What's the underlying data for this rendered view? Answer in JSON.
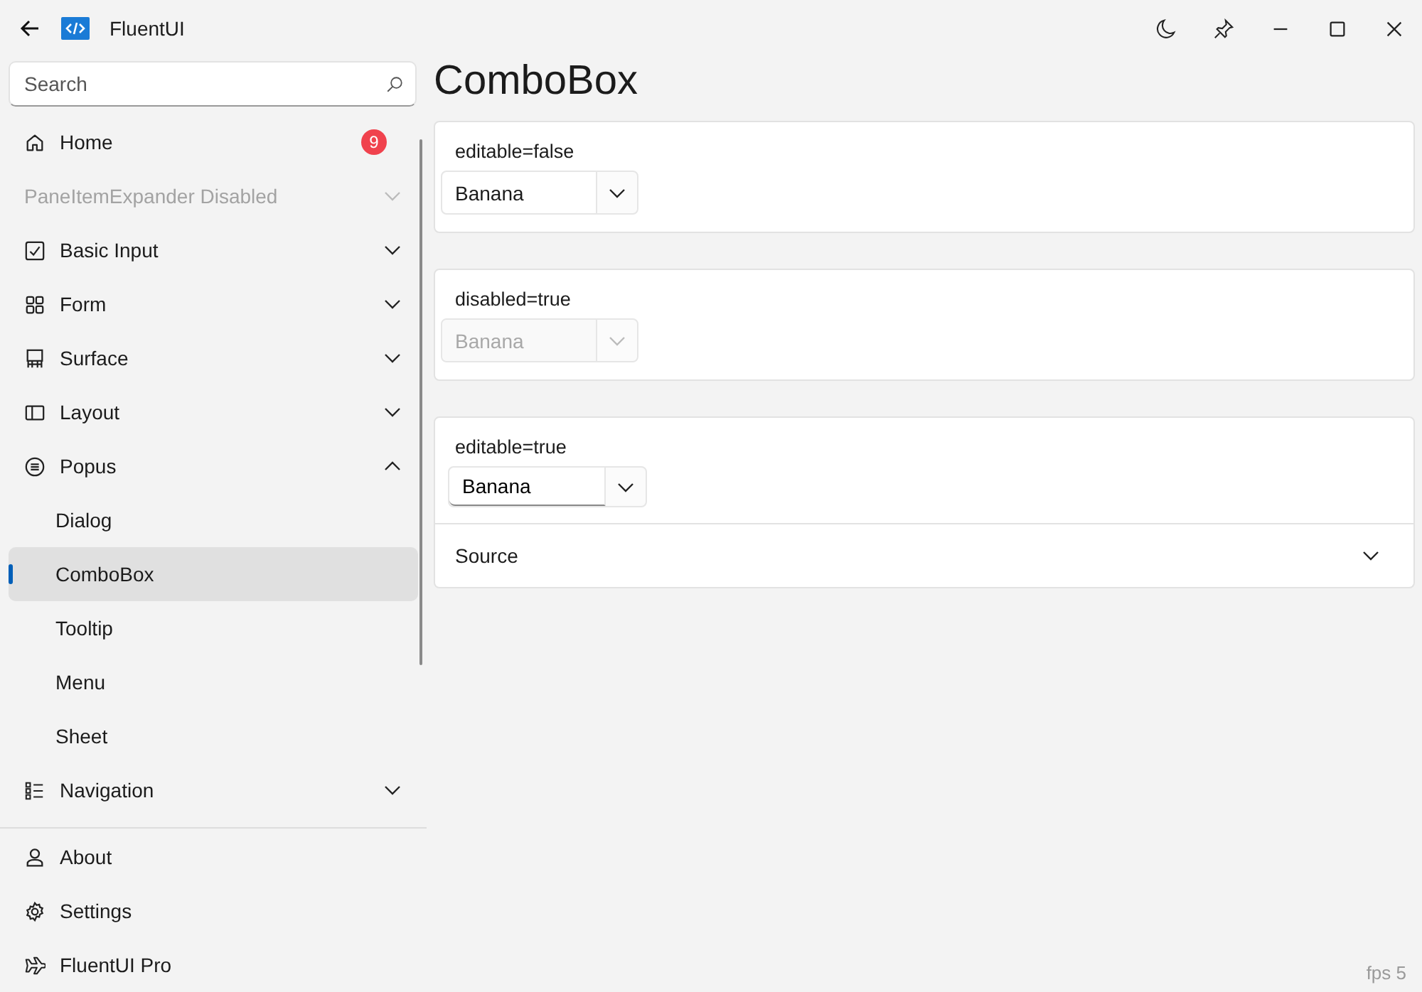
{
  "window": {
    "title": "FluentUI"
  },
  "search": {
    "placeholder": "Search"
  },
  "nav": [
    {
      "label": "Home",
      "badge": "9",
      "disabled": false,
      "selected": false
    },
    {
      "label": "PaneItemExpander Disabled",
      "disabled": true,
      "expanded": false,
      "selected": false
    },
    {
      "label": "Basic Input",
      "disabled": false,
      "expanded": false,
      "selected": false
    },
    {
      "label": "Form",
      "disabled": false,
      "expanded": false,
      "selected": false
    },
    {
      "label": "Surface",
      "disabled": false,
      "expanded": false,
      "selected": false
    },
    {
      "label": "Layout",
      "disabled": false,
      "expanded": false,
      "selected": false
    },
    {
      "label": "Popus",
      "disabled": false,
      "expanded": true,
      "selected": false,
      "children": [
        {
          "label": "Dialog",
          "selected": false
        },
        {
          "label": "ComboBox",
          "selected": true
        },
        {
          "label": "Tooltip",
          "selected": false
        },
        {
          "label": "Menu",
          "selected": false
        },
        {
          "label": "Sheet",
          "selected": false
        }
      ]
    },
    {
      "label": "Navigation",
      "disabled": false,
      "expanded": false,
      "selected": false
    }
  ],
  "footer": [
    {
      "label": "About",
      "selected": false
    },
    {
      "label": "Settings",
      "selected": false
    },
    {
      "label": "FluentUI Pro",
      "selected": false
    }
  ],
  "page": {
    "title": "ComboBox"
  },
  "examples": [
    {
      "label": "editable=false",
      "value": "Banana",
      "editable": false,
      "disabled": false
    },
    {
      "label": "disabled=true",
      "value": "Banana",
      "editable": false,
      "disabled": true
    },
    {
      "label": "editable=true",
      "value": "Banana",
      "editable": true,
      "disabled": false
    }
  ],
  "source": {
    "label": "Source",
    "expanded": false
  },
  "status": {
    "fps": "fps 5"
  }
}
